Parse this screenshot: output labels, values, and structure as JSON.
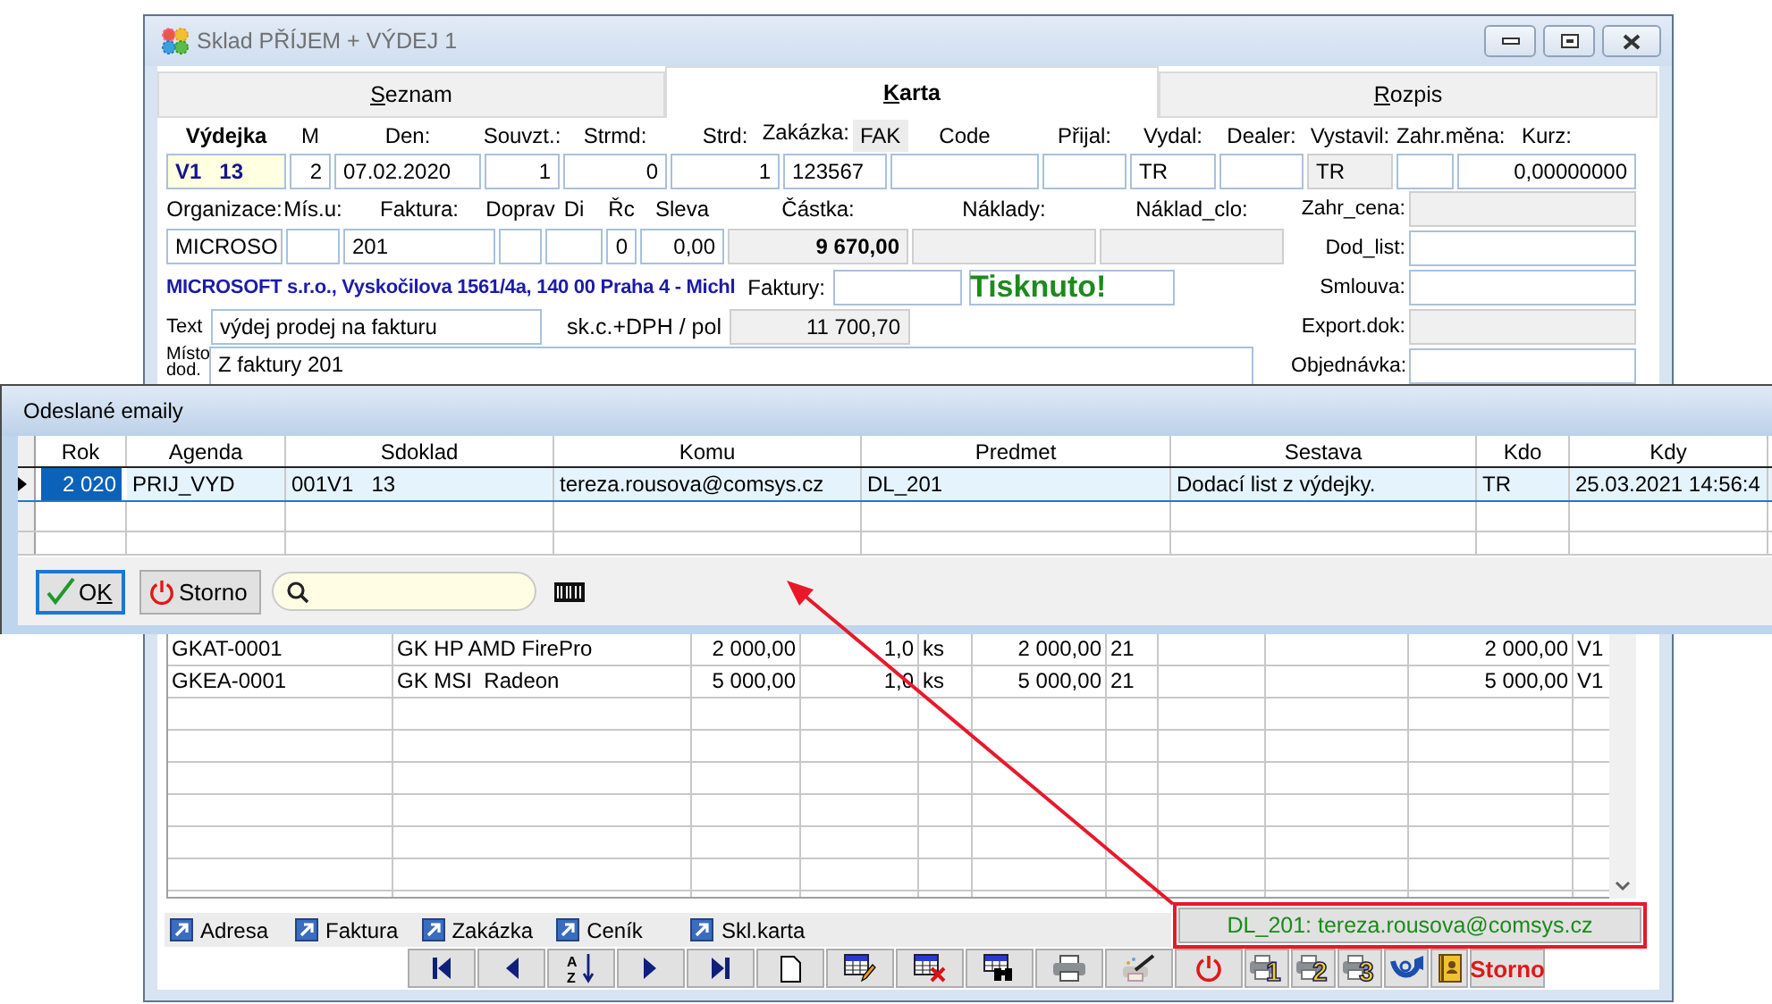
{
  "window": {
    "title": "Sklad PŘÍJEM + VÝDEJ 1"
  },
  "tabs": [
    {
      "key": "S",
      "tail": "eznam",
      "selected": false
    },
    {
      "key": "K",
      "tail": "arta",
      "selected": true
    },
    {
      "key": "R",
      "tail": "ozpis",
      "selected": false
    }
  ],
  "form": {
    "header": [
      {
        "label": "Výdejka",
        "value": "V1   13",
        "kind": "current"
      },
      {
        "label": "M",
        "value": "2",
        "kind": "edit",
        "numeric": true
      },
      {
        "label": "Den:",
        "value": "07.02.2020",
        "kind": "edit"
      },
      {
        "label": "Souvzt.:",
        "value": "1",
        "kind": "edit",
        "numeric": true
      },
      {
        "label": "Strmd:",
        "value": "0",
        "kind": "edit",
        "numeric": true
      },
      {
        "label": "Strd:",
        "value": "1",
        "kind": "edit",
        "numeric": true
      },
      {
        "label": "Zakázka:",
        "tag": "FAK",
        "value": "123567",
        "kind": "edit"
      },
      {
        "label": "Code",
        "kind": "edit"
      },
      {
        "label": "Přijal:",
        "kind": "edit"
      },
      {
        "label": "Vydal:",
        "value": "TR",
        "kind": "edit"
      },
      {
        "label": "Dealer:",
        "kind": "edit"
      },
      {
        "label": "Vystavil:",
        "value": "TR",
        "kind": "readonly"
      },
      {
        "label": "Zahr.měna:",
        "kind": "edit"
      },
      {
        "label": "Kurz:",
        "value": "0,00000000",
        "kind": "edit",
        "numeric": true
      }
    ],
    "second": [
      {
        "label": "Organizace:",
        "value": "MICROSO",
        "kind": "edit"
      },
      {
        "label": "Mís.u:",
        "kind": "edit"
      },
      {
        "label": "Faktura:",
        "value": "201",
        "kind": "edit"
      },
      {
        "label": "Doprav",
        "kind": "edit"
      },
      {
        "label": "Di",
        "kind": "edit"
      },
      {
        "label": "Řc",
        "value": "0",
        "kind": "edit",
        "numeric": true
      },
      {
        "label": "Sleva",
        "value": "0,00",
        "kind": "edit",
        "numeric": true
      },
      {
        "label": "Částka:",
        "value": "9 670,00",
        "kind": "readonly",
        "numeric": true,
        "bold": true
      },
      {
        "label": "Náklady:",
        "kind": "readonly"
      },
      {
        "label": "Náklad_clo:",
        "kind": "readonly"
      }
    ],
    "company": "MICROSOFT s.r.o., Vyskočilova 1561/4a, 140 00 Praha 4 - Michl",
    "faktury": {
      "label": "Faktury:",
      "status": "Tisknuto!"
    },
    "text": {
      "label": "Text",
      "value": "výdej prodej na fakturu"
    },
    "unit_price": {
      "label": "sk.c.+DPH / pol",
      "value": "11 700,70"
    },
    "delivery": {
      "label": "Místo dod.",
      "value": "Z faktury 201"
    },
    "side": [
      {
        "label": "Zahr_cena:",
        "kind": "readonly"
      },
      {
        "label": "Dod_list:",
        "kind": "edit"
      },
      {
        "label": "Smlouva:",
        "kind": "edit"
      },
      {
        "label": "Export.dok:",
        "kind": "readonly"
      },
      {
        "label": "Objednávka:",
        "kind": "edit"
      }
    ]
  },
  "items": [
    {
      "column_1": "GKAT-0001",
      "column_2": "GK HP AMD FirePro",
      "column_3": "2 000,00",
      "column_4": "1,0",
      "column_5": "ks",
      "column_6": "2 000,00",
      "column_7": "21",
      "column_10": "2 000,00",
      "column_11": "V1"
    },
    {
      "column_1": "GKEA-0001",
      "column_2": "GK MSI  Radeon",
      "column_3": "5 000,00",
      "column_4": "1,0",
      "column_5": "ks",
      "column_6": "5 000,00",
      "column_7": "21",
      "column_10": "5 000,00",
      "column_11": "V1"
    }
  ],
  "links": [
    "Adresa",
    "Faktura",
    "Zakázka",
    "Ceník",
    "Skl.karta"
  ],
  "status": {
    "text": "DL_201: tereza.rousova@comsys.cz",
    "highlighted": true
  },
  "toolbar": {
    "sort_letters": [
      "A",
      "Z"
    ],
    "print_numbers": [
      "1",
      "2",
      "3"
    ],
    "cancel_label": "Storno"
  },
  "dialog": {
    "title": "Odeslané emaily",
    "columns": [
      "Rok",
      "Agenda",
      "Sdoklad",
      "Komu",
      "Predmet",
      "Sestava",
      "Kdo",
      "Kdy"
    ],
    "rows": [
      {
        "selected": true,
        "cells": [
          {
            "text": "2 020",
            "focused": true
          },
          {
            "text": "PRIJ_VYD",
            "focused": false
          },
          {
            "text": "001V1   13",
            "focused": false
          },
          {
            "text": "tereza.rousova@comsys.cz",
            "focused": false
          },
          {
            "text": "DL_201",
            "focused": false
          },
          {
            "text": "Dodací list z výdejky.",
            "focused": false
          },
          {
            "text": "TR",
            "focused": false
          },
          {
            "text": "25.03.2021 14:56:4",
            "focused": false
          }
        ]
      }
    ],
    "buttons": [
      {
        "lead": "O",
        "key": "K",
        "kind": "ok",
        "focused": true
      },
      {
        "lead": "Storno",
        "kind": "cancel",
        "focused": false
      }
    ]
  }
}
